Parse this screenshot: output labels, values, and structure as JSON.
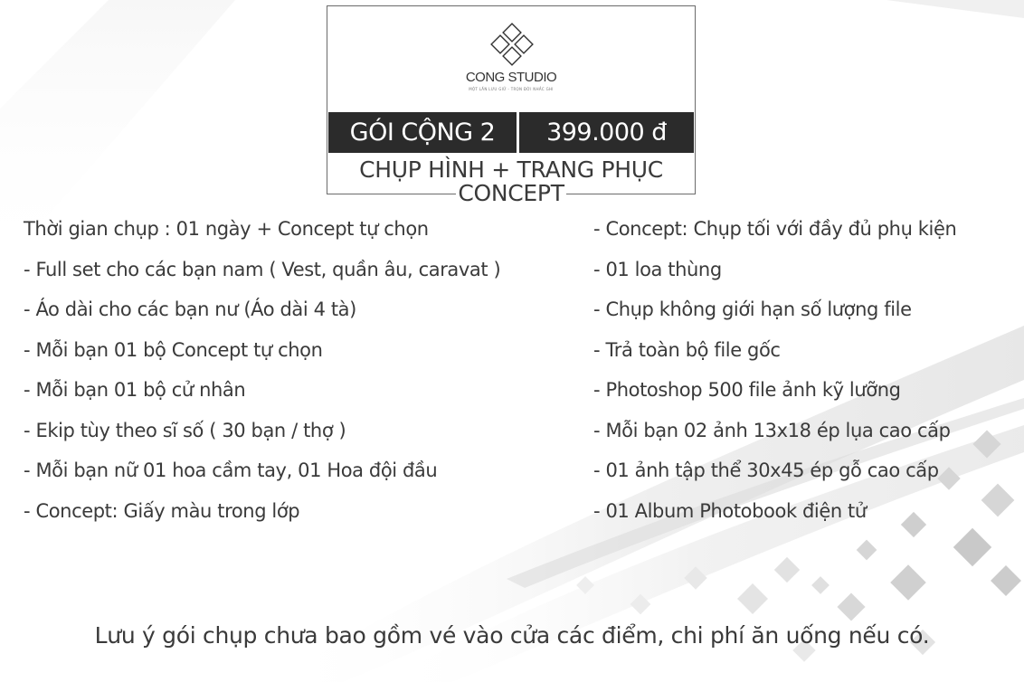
{
  "studio": {
    "name": "CONG STUDIO",
    "slogan": "MỘT LẦN LƯU GIỮ - TRỌN ĐỜI NHẮC GHI",
    "logo_icon": "diamond-flower-icon"
  },
  "package": {
    "name": "GÓI CỘNG 2",
    "price": "399.000 đ",
    "subtitle_line1": "CHỤP HÌNH + TRANG PHỤC",
    "subtitle_line2": "CONCEPT"
  },
  "left_items": [
    "Thời gian chụp : 01 ngày + Concept tự chọn",
    "- Full set cho các bạn nam ( Vest, quần âu, caravat )",
    "- Áo dài cho các bạn nư (Áo dài 4 tà)",
    "- Mỗi bạn 01 bộ Concept tự chọn",
    "- Mỗi bạn 01 bộ cử nhân",
    "- Ekip tùy theo sĩ số ( 30 bạn / thợ )",
    "- Mỗi bạn nữ 01 hoa cầm tay, 01 Hoa đội đầu",
    "- Concept: Giấy màu trong lớp"
  ],
  "right_items": [
    "- Concept: Chụp tối với đầy đủ phụ kiện",
    "- 01 loa thùng",
    "- Chụp không giới hạn số lượng file",
    "- Trả toàn bộ file gốc",
    "- Photoshop 500 file ảnh kỹ lưỡng",
    "- Mỗi bạn 02 ảnh 13x18 ép lụa cao cấp",
    "- 01 ảnh tập thể 30x45 ép gỗ cao cấp",
    "- 01 Album Photobook điện tử"
  ],
  "note": "Lưu ý gói chụp chưa bao gồm vé vào cửa các điểm, chi phí ăn uống nếu có.",
  "colors": {
    "text": "#3a3a3a",
    "bar": "#2b2b2b",
    "border": "#6b6b6b"
  }
}
